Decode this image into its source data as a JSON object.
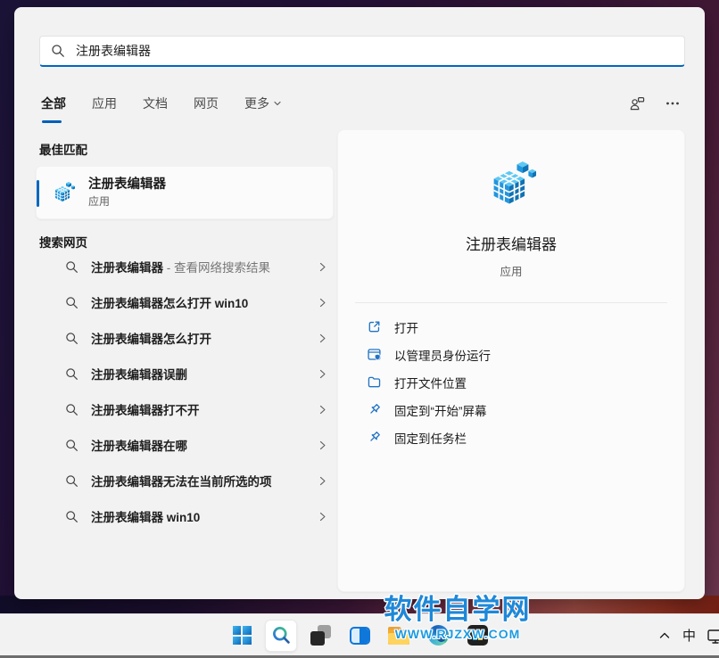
{
  "search_box": {
    "value": "注册表编辑器"
  },
  "tabs": {
    "items": [
      {
        "label": "全部",
        "active": true
      },
      {
        "label": "应用"
      },
      {
        "label": "文档"
      },
      {
        "label": "网页"
      },
      {
        "label": "更多",
        "has_dropdown": true
      }
    ]
  },
  "best_match": {
    "header": "最佳匹配",
    "result": {
      "name": "注册表编辑器",
      "type": "应用"
    }
  },
  "web_search": {
    "header": "搜索网页",
    "items": [
      {
        "query": "注册表编辑器",
        "suffix": " - 查看网络搜索结果"
      },
      {
        "query": "注册表编辑器怎么打开 win10"
      },
      {
        "query": "注册表编辑器怎么打开"
      },
      {
        "query": "注册表编辑器误删"
      },
      {
        "query": "注册表编辑器打不开"
      },
      {
        "query": "注册表编辑器在哪"
      },
      {
        "query": "注册表编辑器无法在当前所选的项"
      },
      {
        "query": "注册表编辑器 win10"
      }
    ]
  },
  "details": {
    "app_name": "注册表编辑器",
    "app_type": "应用",
    "actions": [
      {
        "icon": "open-icon",
        "label": "打开"
      },
      {
        "icon": "run-as-admin-icon",
        "label": "以管理员身份运行"
      },
      {
        "icon": "open-file-location-icon",
        "label": "打开文件位置"
      },
      {
        "icon": "pin-to-start-icon",
        "label": "固定到“开始”屏幕"
      },
      {
        "icon": "pin-to-taskbar-icon",
        "label": "固定到任务栏"
      }
    ]
  },
  "taskbar": {
    "items": [
      "start",
      "search",
      "task-view",
      "widgets",
      "file-explorer",
      "edge",
      "microsoft-app"
    ],
    "ime_label": "中"
  },
  "watermark": {
    "title": "软件自学网",
    "url": "WWW.RJZXW.COM"
  },
  "colors": {
    "accent_blue": "#0067c0",
    "tab_underline": "#005fb8",
    "action_icon_blue": "#2173c4",
    "watermark_blue": "#1e88d8",
    "panel_bg": "#f2f2f2",
    "card_bg": "#fbfbfb"
  }
}
